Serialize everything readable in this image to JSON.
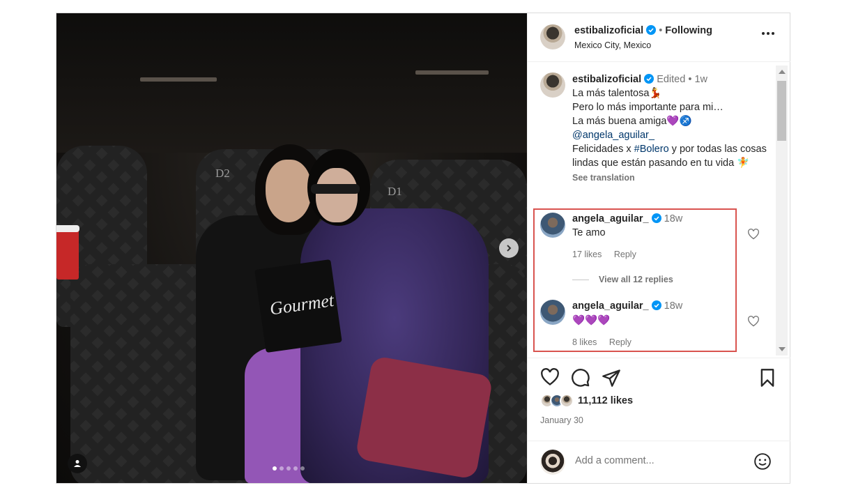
{
  "post": {
    "author": "estibalizoficial",
    "follow_status": "Following",
    "separator": "•",
    "location": "Mexico City, Mexico",
    "carousel_dots": 5,
    "active_dot": 0,
    "photo_text": {
      "seat_left": "D2",
      "seat_right": "D1",
      "popcorn_brand": "Gourmet"
    }
  },
  "caption": {
    "author": "estibalizoficial",
    "edited": "Edited",
    "dot": "•",
    "time": "1w",
    "line1": "La más talentosa💃",
    "line2": "Pero lo más importante para mi…",
    "line3": "La más buena amiga💜♐",
    "mention": "@angela_aguilar_",
    "line5_prefix": "Felicidades x ",
    "hashtag": "#Bolero",
    "line5_suffix": " y por todas las cosas lindas que están pasando en tu vida 🧚",
    "see_translation": "See translation"
  },
  "comments": [
    {
      "author": "angela_aguilar_",
      "time": "18w",
      "text": "Te amo",
      "likes": "17 likes",
      "reply": "Reply"
    },
    {
      "author": "angela_aguilar_",
      "time": "18w",
      "text": "💜💜💜",
      "likes": "8 likes",
      "reply": "Reply"
    }
  ],
  "view_replies": "View all 12 replies",
  "stats": {
    "likes": "11,112 likes",
    "date": "January 30"
  },
  "comment_box": {
    "placeholder": "Add a comment..."
  },
  "icons": [
    "more-icon",
    "verified-icon",
    "heart-icon",
    "comment-icon",
    "share-icon",
    "bookmark-icon",
    "emoji-icon",
    "chevron-right-icon",
    "user-tag-icon"
  ],
  "colors": {
    "verified": "#0095f6",
    "link": "#00376b",
    "highlight_border": "#d9534f",
    "secondary_text": "#737373"
  }
}
